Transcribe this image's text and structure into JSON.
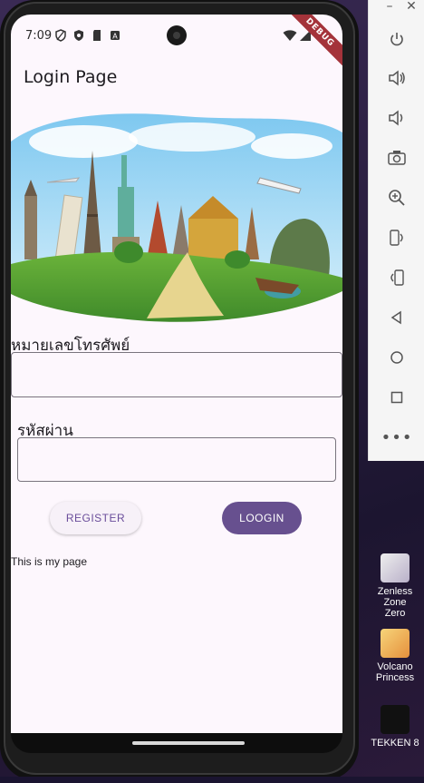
{
  "status": {
    "time": "7:09",
    "debug_banner": "DEBUG"
  },
  "appbar": {
    "title": "Login Page"
  },
  "hero": {
    "icon": "world-landmarks-illustration"
  },
  "form": {
    "phone_label": "หมายเลขโทรศัพย์",
    "phone_value": "",
    "password_label": "รหัสผ่าน",
    "password_value": ""
  },
  "buttons": {
    "register": "REGISTER",
    "login": "LOOGIN"
  },
  "footer_note": "This is my page",
  "desktop": {
    "items": [
      {
        "label_line1": "Zenless Zone",
        "label_line2": "Zero",
        "icon": "zenless-zone-zero-icon"
      },
      {
        "label_line1": "Volcano",
        "label_line2": "Princess",
        "icon": "volcano-princess-icon"
      },
      {
        "label_line1": "TEKKEN 8",
        "label_line2": "",
        "icon": "tekken-8-icon"
      }
    ]
  },
  "colors": {
    "primary": "#67508f",
    "surface": "#fdf7fd",
    "debug": "#a4333a"
  }
}
